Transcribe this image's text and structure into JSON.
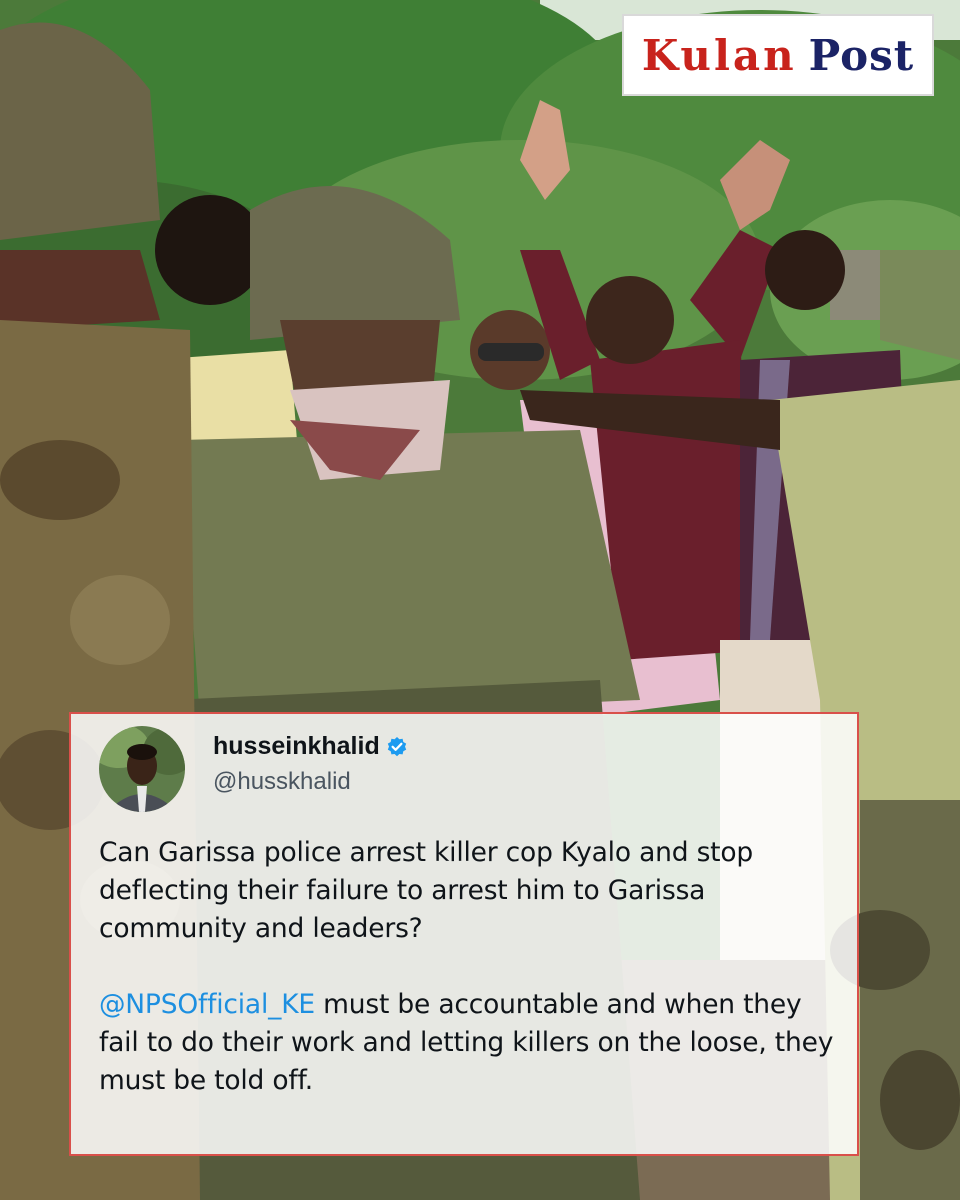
{
  "brand": {
    "word1": "Kulan",
    "word2": "Post"
  },
  "tweet": {
    "display_name": "husseinkhalid",
    "handle": "@husskhalid",
    "verified_icon": "verified-badge-icon",
    "paragraph1": "Can Garissa police arrest killer cop Kyalo and stop deflecting their failure to arrest him to Garissa community and leaders?",
    "mention": "@NPSOfficial_KE",
    "paragraph2_rest": " must be accountable and when they fail to do their work and letting killers on the loose, they must be told off."
  },
  "colors": {
    "brand_red": "#c8231c",
    "brand_navy": "#1b2366",
    "card_border": "#d9504a",
    "mention_blue": "#1d8fe0",
    "verified_blue": "#1d9bf0"
  }
}
